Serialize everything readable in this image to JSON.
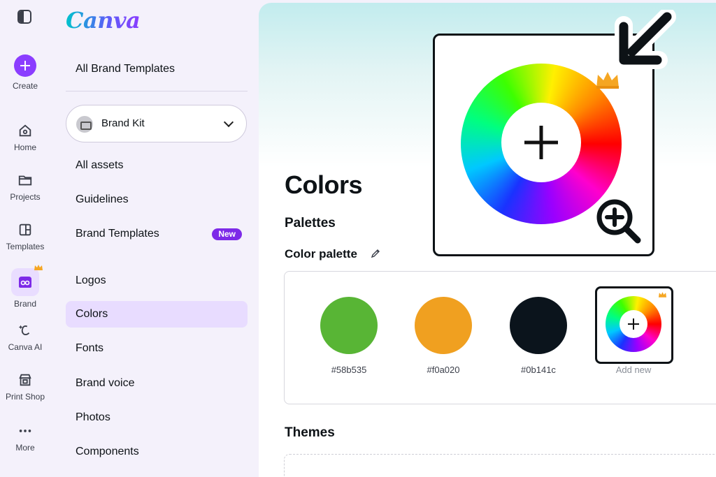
{
  "rail": {
    "create": "Create",
    "items": [
      {
        "label": "Home",
        "icon": "home-icon"
      },
      {
        "label": "Projects",
        "icon": "folder-icon"
      },
      {
        "label": "Templates",
        "icon": "templates-icon"
      },
      {
        "label": "Brand",
        "icon": "brand-icon"
      },
      {
        "label": "Canva AI",
        "icon": "canva-ai-icon"
      },
      {
        "label": "Print Shop",
        "icon": "print-shop-icon"
      },
      {
        "label": "More",
        "icon": "more-icon"
      }
    ]
  },
  "sidebar": {
    "logo": "Canva",
    "all_brand_templates": "All Brand Templates",
    "brand_kit": "Brand Kit",
    "items": [
      {
        "label": "All assets"
      },
      {
        "label": "Guidelines"
      },
      {
        "label": "Brand Templates",
        "badge": "New"
      },
      {
        "label": "Logos"
      },
      {
        "label": "Colors",
        "active": true
      },
      {
        "label": "Fonts"
      },
      {
        "label": "Brand voice"
      },
      {
        "label": "Photos"
      },
      {
        "label": "Components"
      }
    ]
  },
  "main": {
    "title": "Colors",
    "palettes_heading": "Palettes",
    "color_palette_heading": "Color palette",
    "swatches": [
      {
        "hex": "#58b535",
        "label": "#58b535"
      },
      {
        "hex": "#f0a020",
        "label": "#f0a020"
      },
      {
        "hex": "#0b141c",
        "label": "#0b141c"
      }
    ],
    "add_new_label": "Add new",
    "themes_heading": "Themes"
  },
  "colors": {
    "accent": "#8b3dff",
    "badge": "#7d2ae8",
    "active_item": "#e8dcff",
    "crown": "#f5a623"
  }
}
